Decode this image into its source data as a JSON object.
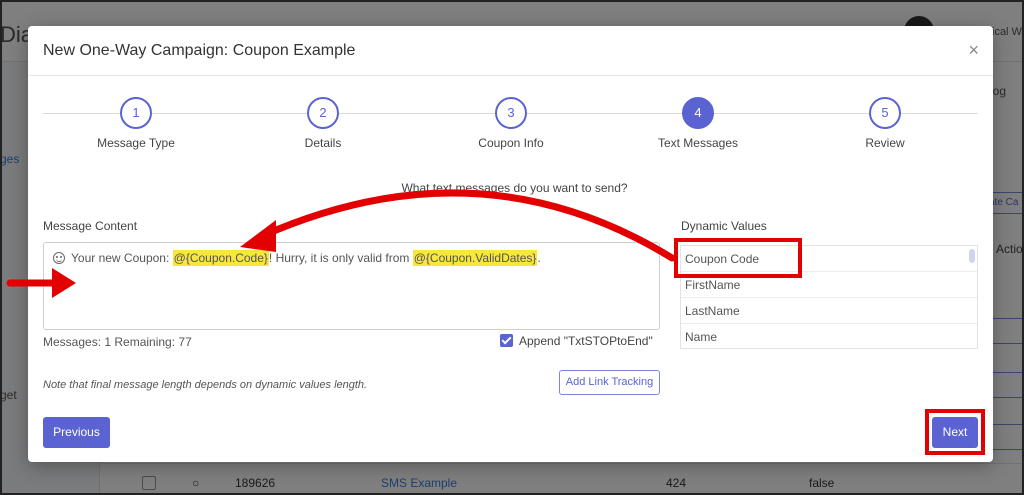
{
  "background": {
    "brand_fragment": "Dia",
    "user_fragment": "ical W",
    "log_fragment": "log",
    "side_link_fragment": "ges",
    "side_text_fragment": "get",
    "create_btn_fragment": "ate Ca",
    "actions_fragment": "Actio",
    "row": {
      "id": "189626",
      "name": "SMS Example",
      "count": "424",
      "flag": "false"
    }
  },
  "modal": {
    "title": "New One-Way Campaign: Coupon Example",
    "close_label": "×",
    "steps": [
      {
        "number": "1",
        "label": "Message Type"
      },
      {
        "number": "2",
        "label": "Details"
      },
      {
        "number": "3",
        "label": "Coupon Info"
      },
      {
        "number": "4",
        "label": "Text Messages",
        "active": true
      },
      {
        "number": "5",
        "label": "Review"
      }
    ],
    "question": "What text messages do you want to send?",
    "message_content_label": "Message Content",
    "message": {
      "part1": "Your new Coupon: ",
      "token1": "@{Coupon.Code}",
      "part2": "! Hurry, it is only valid from ",
      "token2": "@{Coupon.ValidDates}",
      "part3": "."
    },
    "counts": "Messages: 1 Remaining: 77",
    "append_label": "Append \"TxtSTOPtoEnd\"",
    "note": "Note that final message length depends on dynamic values length.",
    "link_tracking_label": "Add Link Tracking",
    "dynamic_values_label": "Dynamic Values",
    "dynamic_values": [
      "Coupon Code",
      "FirstName",
      "LastName",
      "Name"
    ],
    "previous_label": "Previous",
    "next_label": "Next"
  },
  "colors": {
    "primary": "#5b63d3",
    "highlight": "#f6e73a",
    "annotation": "#e30000"
  }
}
